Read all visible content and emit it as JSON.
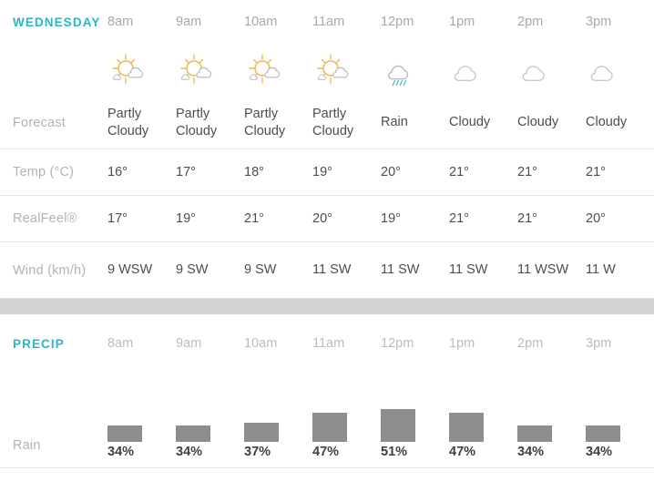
{
  "colors": {
    "accent": "#29b8c6",
    "label": "#b3b3b3",
    "value": "#4d4d4d",
    "bar": "#8d8d8d",
    "divider": "#e9e9e9",
    "band": "#d4d4d4",
    "sun": "#f5b841",
    "cloud": "#b9bec4",
    "rain": "#29b8c6"
  },
  "forecast_section": {
    "day_label": "WEDNESDAY",
    "hours": [
      "8am",
      "9am",
      "10am",
      "11am",
      "12pm",
      "1pm",
      "2pm",
      "3pm"
    ],
    "icons": [
      "partly-cloudy-icon",
      "partly-cloudy-icon",
      "partly-cloudy-icon",
      "partly-cloudy-icon",
      "rain-icon",
      "cloudy-icon",
      "cloudy-icon",
      "cloudy-icon"
    ],
    "rows": [
      {
        "label": "Forecast",
        "values": [
          "Partly Cloudy",
          "Partly Cloudy",
          "Partly Cloudy",
          "Partly Cloudy",
          "Rain",
          "Cloudy",
          "Cloudy",
          "Cloudy"
        ]
      },
      {
        "label": "Temp (°C)",
        "values": [
          "16°",
          "17°",
          "18°",
          "19°",
          "20°",
          "21°",
          "21°",
          "21°"
        ]
      },
      {
        "label": "RealFeel®",
        "values": [
          "17°",
          "19°",
          "21°",
          "20°",
          "19°",
          "21°",
          "21°",
          "20°"
        ]
      },
      {
        "label": "Wind (km/h)",
        "values": [
          "9 WSW",
          "9 SW",
          "9 SW",
          "11 SW",
          "11 SW",
          "11 SW",
          "11 WSW",
          "11 W"
        ]
      }
    ]
  },
  "precip_section": {
    "title": "PRECIP",
    "hours": [
      "8am",
      "9am",
      "10am",
      "11am",
      "12pm",
      "1pm",
      "2pm",
      "3pm"
    ],
    "row_label": "Rain"
  },
  "chart_data": {
    "type": "bar",
    "title": "PRECIP",
    "xlabel": "",
    "ylabel": "Rain",
    "categories": [
      "8am",
      "9am",
      "10am",
      "11am",
      "12pm",
      "1pm",
      "2pm",
      "3pm"
    ],
    "values": [
      34,
      34,
      37,
      47,
      51,
      47,
      34,
      34
    ],
    "value_labels": [
      "34%",
      "34%",
      "37%",
      "47%",
      "51%",
      "47%",
      "34%",
      "34%"
    ],
    "ylim": [
      0,
      51
    ],
    "grid": false,
    "legend": "none"
  }
}
